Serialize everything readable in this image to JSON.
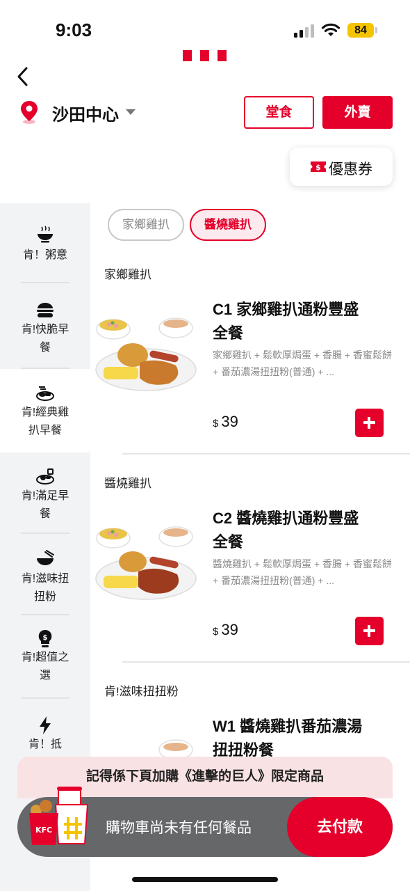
{
  "status_bar": {
    "time": "9:03",
    "battery": "84"
  },
  "header": {
    "store_name": "沙田中心",
    "dine_in_label": "堂食",
    "delivery_label": "外賣",
    "coupon_label": "優惠券"
  },
  "sidebar": {
    "items": [
      {
        "label_line1": "肯！粥意",
        "label_line2": "",
        "icon": "congee-bowl-icon"
      },
      {
        "label_line1": "肯!快脆早",
        "label_line2": "餐",
        "icon": "burger-icon"
      },
      {
        "label_line1": "肯!經典雞",
        "label_line2": "扒早餐",
        "icon": "breakfast-plate-icon"
      },
      {
        "label_line1": "肯!滿足早",
        "label_line2": "餐",
        "icon": "meal-plate-icon"
      },
      {
        "label_line1": "肯!滋味扭",
        "label_line2": "扭粉",
        "icon": "noodle-bowl-icon"
      },
      {
        "label_line1": "肯!超值之",
        "label_line2": "選",
        "icon": "lightbulb-dollar-icon"
      },
      {
        "label_line1": "肯！抵",
        "label_line2": "",
        "icon": "lightning-icon"
      }
    ]
  },
  "chips": {
    "chip1": "家鄉雞扒",
    "chip2": "醬燒雞扒"
  },
  "sections": {
    "s1": "家鄉雞扒",
    "s2": "醬燒雞扒",
    "s3": "肯!滋味扭扭粉"
  },
  "products": {
    "p1": {
      "name": "C1 家鄉雞扒通粉豐盛全餐",
      "desc": "家鄉雞扒 + 鬆軟厚焗蛋 + 香腸 + 香蜜鬆餅 + 番茄濃湯扭扭粉(普通) + ...",
      "currency": "$",
      "price": "39"
    },
    "p2": {
      "name": "C2 醬燒雞扒通粉豐盛全餐",
      "desc": "醬燒雞扒 + 鬆軟厚焗蛋 + 香腸 + 香蜜鬆餅 + 番茄濃湯扭扭粉(普通) + ...",
      "currency": "$",
      "price": "39"
    },
    "p3": {
      "name": "W1 醬燒雞扒番茄濃湯扭扭粉餐"
    }
  },
  "promo": {
    "text": "記得係下頁加購《進擊的巨人》限定商品"
  },
  "cart": {
    "empty_text": "購物車尚未有任何餐品",
    "checkout_label": "去付款",
    "brand_text": "KFC"
  },
  "colors": {
    "brand_red": "#e4002b",
    "sidebar_bg": "#f2f3f5",
    "cart_bar": "#666769"
  }
}
